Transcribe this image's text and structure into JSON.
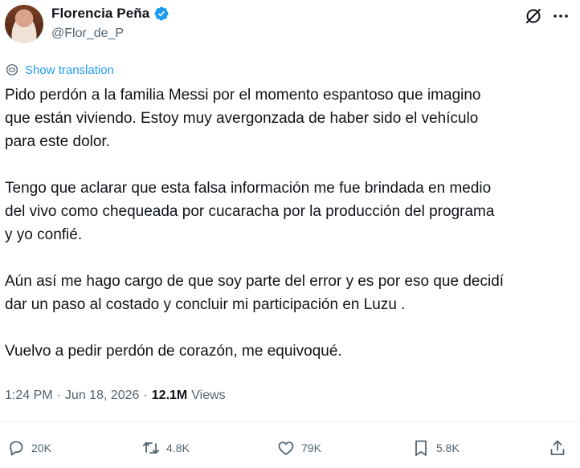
{
  "author": {
    "name": "Florencia Peña",
    "handle": "@Flor_de_P"
  },
  "icons": {
    "verified": "verified-badge-icon",
    "grok": "grok-icon",
    "more": "more-icon",
    "translate": "globe-icon",
    "reply": "reply-icon",
    "retweet": "retweet-icon",
    "like": "like-icon",
    "bookmark": "bookmark-icon",
    "share": "share-icon"
  },
  "colors": {
    "accent": "#1d9bf0",
    "secondary_text": "#536471",
    "primary_text": "#0f1419"
  },
  "translate_label": "Show translation",
  "tweet": {
    "text": "Pido perdón a la familia Messi por el momento espantoso que imagino\nque están viviendo. Estoy muy avergonzada de haber sido el vehículo\npara este dolor.\n\nTengo que aclarar que esta falsa información me fue brindada en medio\ndel vivo como chequeada por cucaracha por la producción del programa\ny yo confié.\n\nAún así me hago cargo de que soy parte del error y es por eso que decidí\ndar un paso al costado y concluir mi participación en Luzu .\n\nVuelvo a pedir perdón de corazón, me equivoqué."
  },
  "meta": {
    "time": "1:24 PM",
    "separator1": "·",
    "date": "Jun 18, 2026",
    "separator2": "·",
    "views_count": "12.1M",
    "views_label": "Views"
  },
  "actions": {
    "replies": "20K",
    "retweets": "4.8K",
    "likes": "79K",
    "bookmarks": "5.8K"
  }
}
